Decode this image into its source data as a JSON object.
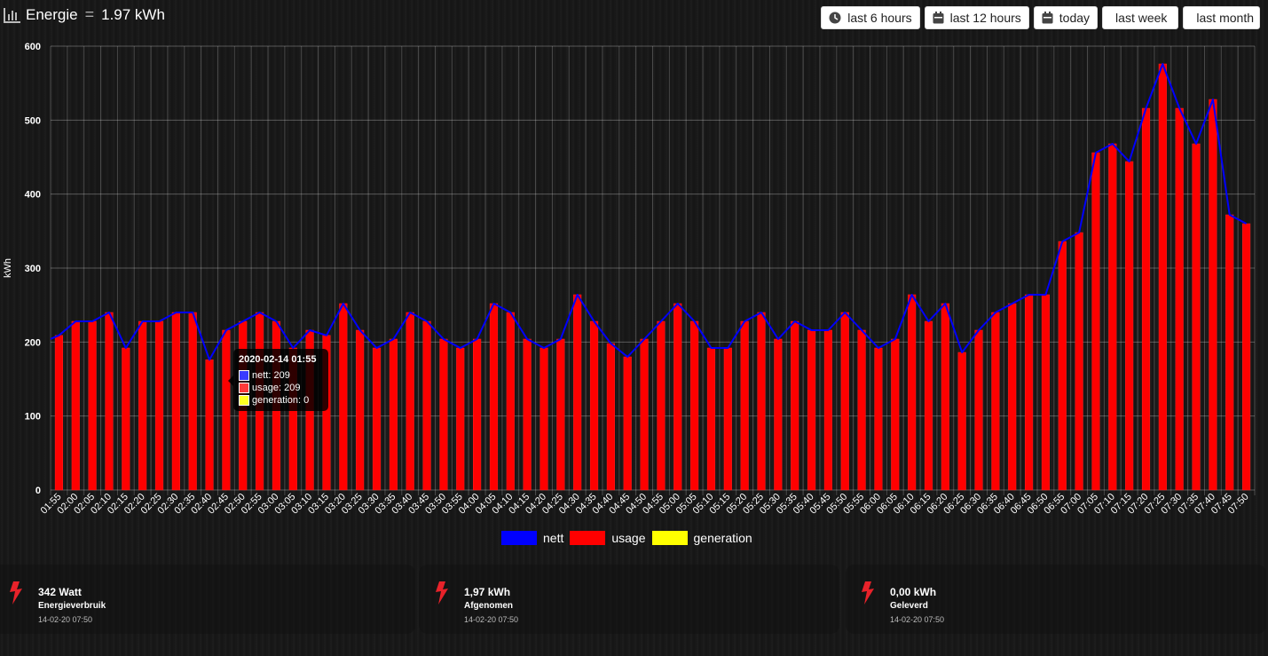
{
  "header": {
    "title": "Energie",
    "total": "1.97 kWh",
    "buttons": [
      {
        "label": "last 6 hours",
        "icon": "clock-icon"
      },
      {
        "label": "last 12 hours",
        "icon": "calendar-icon"
      },
      {
        "label": "today",
        "icon": "calendar-icon"
      },
      {
        "label": "last week",
        "icon": ""
      },
      {
        "label": "last month",
        "icon": ""
      }
    ]
  },
  "chart_data": {
    "type": "bar",
    "ylabel": "kWh",
    "ylim": [
      0,
      600
    ],
    "yticks": [
      0,
      100,
      200,
      300,
      400,
      500,
      600
    ],
    "categories": [
      "01:55",
      "02:00",
      "02:05",
      "02:10",
      "02:15",
      "02:20",
      "02:25",
      "02:30",
      "02:35",
      "02:40",
      "02:45",
      "02:50",
      "02:55",
      "03:00",
      "03:05",
      "03:10",
      "03:15",
      "03:20",
      "03:25",
      "03:30",
      "03:35",
      "03:40",
      "03:45",
      "03:50",
      "03:55",
      "04:00",
      "04:05",
      "04:10",
      "04:15",
      "04:20",
      "04:25",
      "04:30",
      "04:35",
      "04:40",
      "04:45",
      "04:50",
      "04:55",
      "05:00",
      "05:05",
      "05:10",
      "05:15",
      "05:20",
      "05:25",
      "05:30",
      "05:35",
      "05:40",
      "05:45",
      "05:50",
      "05:55",
      "06:00",
      "06:05",
      "06:10",
      "06:15",
      "06:20",
      "06:25",
      "06:30",
      "06:35",
      "06:40",
      "06:45",
      "06:50",
      "06:55",
      "07:00",
      "07:05",
      "07:10",
      "07:15",
      "07:20",
      "07:25",
      "07:30",
      "07:35",
      "07:40",
      "07:45",
      "07:50"
    ],
    "series": [
      {
        "name": "nett",
        "type": "line",
        "color": "#0000ff",
        "values": [
          209,
          228,
          228,
          240,
          192,
          228,
          228,
          240,
          240,
          176,
          216,
          228,
          240,
          228,
          192,
          216,
          209,
          252,
          216,
          192,
          204,
          240,
          228,
          204,
          192,
          204,
          252,
          240,
          204,
          192,
          204,
          264,
          228,
          198,
          180,
          204,
          228,
          252,
          228,
          192,
          192,
          228,
          240,
          204,
          228,
          216,
          216,
          240,
          216,
          192,
          204,
          264,
          228,
          252,
          186,
          216,
          240,
          252,
          264,
          264,
          336,
          348,
          456,
          468,
          444,
          516,
          576,
          516,
          468,
          528,
          372,
          360
        ]
      },
      {
        "name": "usage",
        "type": "bar",
        "color": "#ff0000",
        "values": [
          209,
          228,
          228,
          240,
          192,
          228,
          228,
          240,
          240,
          176,
          216,
          228,
          240,
          228,
          192,
          216,
          209,
          252,
          216,
          192,
          204,
          240,
          228,
          204,
          192,
          204,
          252,
          240,
          204,
          192,
          204,
          264,
          228,
          198,
          180,
          204,
          228,
          252,
          228,
          192,
          192,
          228,
          240,
          204,
          228,
          216,
          216,
          240,
          216,
          192,
          204,
          264,
          228,
          252,
          186,
          216,
          240,
          252,
          264,
          264,
          336,
          348,
          456,
          468,
          444,
          516,
          576,
          516,
          468,
          528,
          372,
          360
        ]
      },
      {
        "name": "generation",
        "type": "bar",
        "color": "#ffff00",
        "values": [
          0,
          0,
          0,
          0,
          0,
          0,
          0,
          0,
          0,
          0,
          0,
          0,
          0,
          0,
          0,
          0,
          0,
          0,
          0,
          0,
          0,
          0,
          0,
          0,
          0,
          0,
          0,
          0,
          0,
          0,
          0,
          0,
          0,
          0,
          0,
          0,
          0,
          0,
          0,
          0,
          0,
          0,
          0,
          0,
          0,
          0,
          0,
          0,
          0,
          0,
          0,
          0,
          0,
          0,
          0,
          0,
          0,
          0,
          0,
          0,
          0,
          0,
          0,
          0,
          0,
          0,
          0,
          0,
          0,
          0,
          0,
          0
        ]
      }
    ],
    "legend_position": "bottom-center",
    "grid": true
  },
  "tooltip": {
    "title": "2020-02-14 01:55",
    "rows": [
      {
        "text": "nett: 209",
        "color": "#3a3aff"
      },
      {
        "text": "usage: 209",
        "color": "#ff3a3a"
      },
      {
        "text": "generation: 0",
        "color": "#ffff22"
      }
    ]
  },
  "cards": [
    {
      "value": "342 Watt",
      "label": "Energieverbruik",
      "time": "14-02-20 07:50",
      "icon": "lightning-icon"
    },
    {
      "value": "1,97 kWh",
      "label": "Afgenomen",
      "time": "14-02-20 07:50",
      "icon": "lightning-icon"
    },
    {
      "value": "0,00 kWh",
      "label": "Geleverd",
      "time": "14-02-20 07:50",
      "icon": "lightning-icon"
    }
  ]
}
